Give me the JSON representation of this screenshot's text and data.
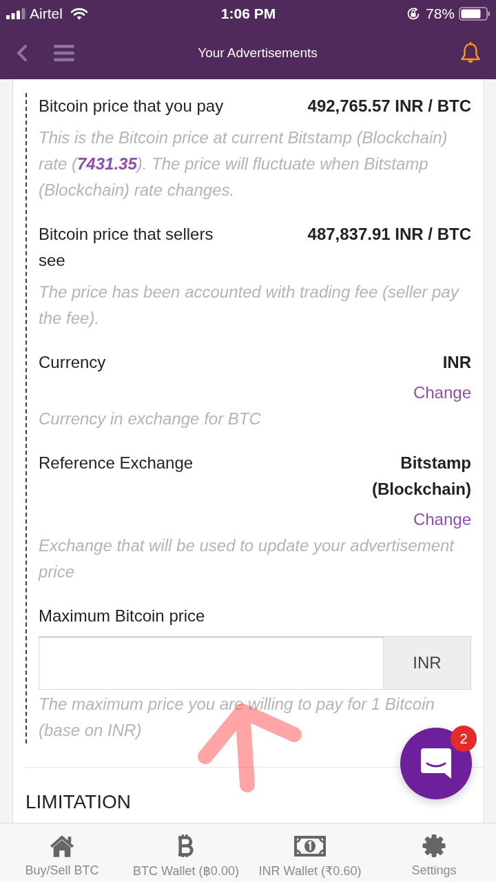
{
  "status_bar": {
    "carrier": "Airtel",
    "time": "1:06 PM",
    "battery": "78%"
  },
  "header": {
    "title": "Your Advertisements"
  },
  "fields": [
    {
      "kind": "value",
      "label": "Bitcoin price that you pay",
      "value": "492,765.57 INR / BTC",
      "hint": "This is the Bitcoin price at current Bitstamp (Blockchain) rate (**7431.35**). The price will fluctuate when Bitstamp (Blockchain) rate changes."
    },
    {
      "kind": "value",
      "label": "Bitcoin price that sellers see",
      "value": "487,837.91 INR / BTC",
      "hint": "The price has been accounted with trading fee (seller pay the fee)."
    },
    {
      "kind": "value",
      "label": "Currency",
      "value": "INR",
      "link": "Change",
      "hint": "Currency in exchange for BTC"
    },
    {
      "kind": "value",
      "label": "Reference Exchange",
      "value": "Bitstamp (Blockchain)",
      "link": "Change",
      "hint": "Exchange that will be used to update your advertisement price"
    },
    {
      "kind": "input",
      "label": "Maximum Bitcoin price",
      "addon": "INR",
      "hint": "The maximum price you are willing to pay for 1 Bitcoin (base on INR)"
    }
  ],
  "section": {
    "title": "LIMITATION"
  },
  "chat": {
    "badge": "2"
  },
  "tab_bar": [
    {
      "label": "Buy/Sell BTC",
      "selected": false
    },
    {
      "label": "BTC Wallet (฿0.00)",
      "selected": false
    },
    {
      "label": "INR Wallet (₹0.60)",
      "selected": false
    },
    {
      "label": "Settings",
      "selected": false
    }
  ]
}
